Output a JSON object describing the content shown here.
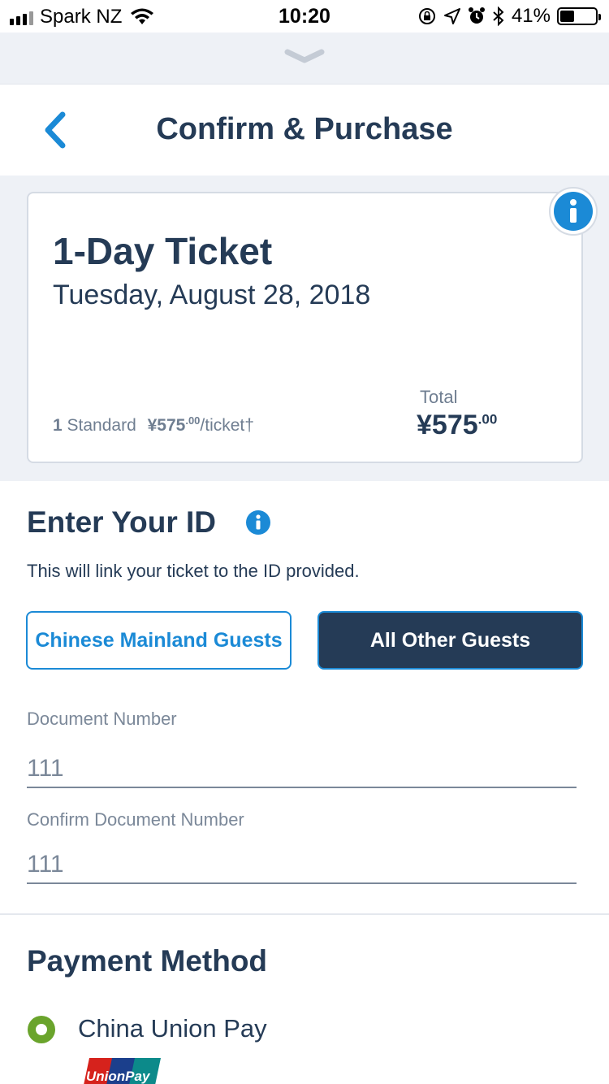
{
  "status_bar": {
    "carrier": "Spark NZ",
    "time": "10:20",
    "battery": "41%",
    "battery_level": 0.41
  },
  "header": {
    "title": "Confirm & Purchase"
  },
  "ticket": {
    "name": "1-Day Ticket",
    "date": "Tuesday, August 28, 2018",
    "quantity": "1",
    "type": "Standard",
    "unit_price": "¥575",
    "unit_price_cents": ".00",
    "per_ticket": "/ticket†",
    "total_label": "Total",
    "total_value": "¥575",
    "total_cents": ".00"
  },
  "id_section": {
    "title": "Enter Your ID",
    "description": "This will link your ticket to the ID provided.",
    "option_mainland": "Chinese Mainland Guests",
    "option_other": "All Other Guests",
    "selected": "All Other Guests",
    "document_label": "Document Number",
    "document_value": "111",
    "confirm_label": "Confirm Document Number",
    "confirm_value": "111"
  },
  "payment": {
    "title": "Payment Method",
    "option": "China Union Pay",
    "logo_text": "UnionPay"
  },
  "colors": {
    "navy": "#253b56",
    "accent_blue": "#1b8ad6",
    "radio_green": "#6aa42c",
    "muted": "#7b8899",
    "panel_bg": "#eef1f6"
  },
  "icons": [
    "signal-icon",
    "wifi-icon",
    "lock-rotation-icon",
    "location-icon",
    "alarm-icon",
    "bluetooth-icon",
    "battery-icon",
    "chevron-down-icon",
    "back-chevron-icon",
    "info-icon",
    "radio-selected-icon",
    "unionpay-logo"
  ]
}
